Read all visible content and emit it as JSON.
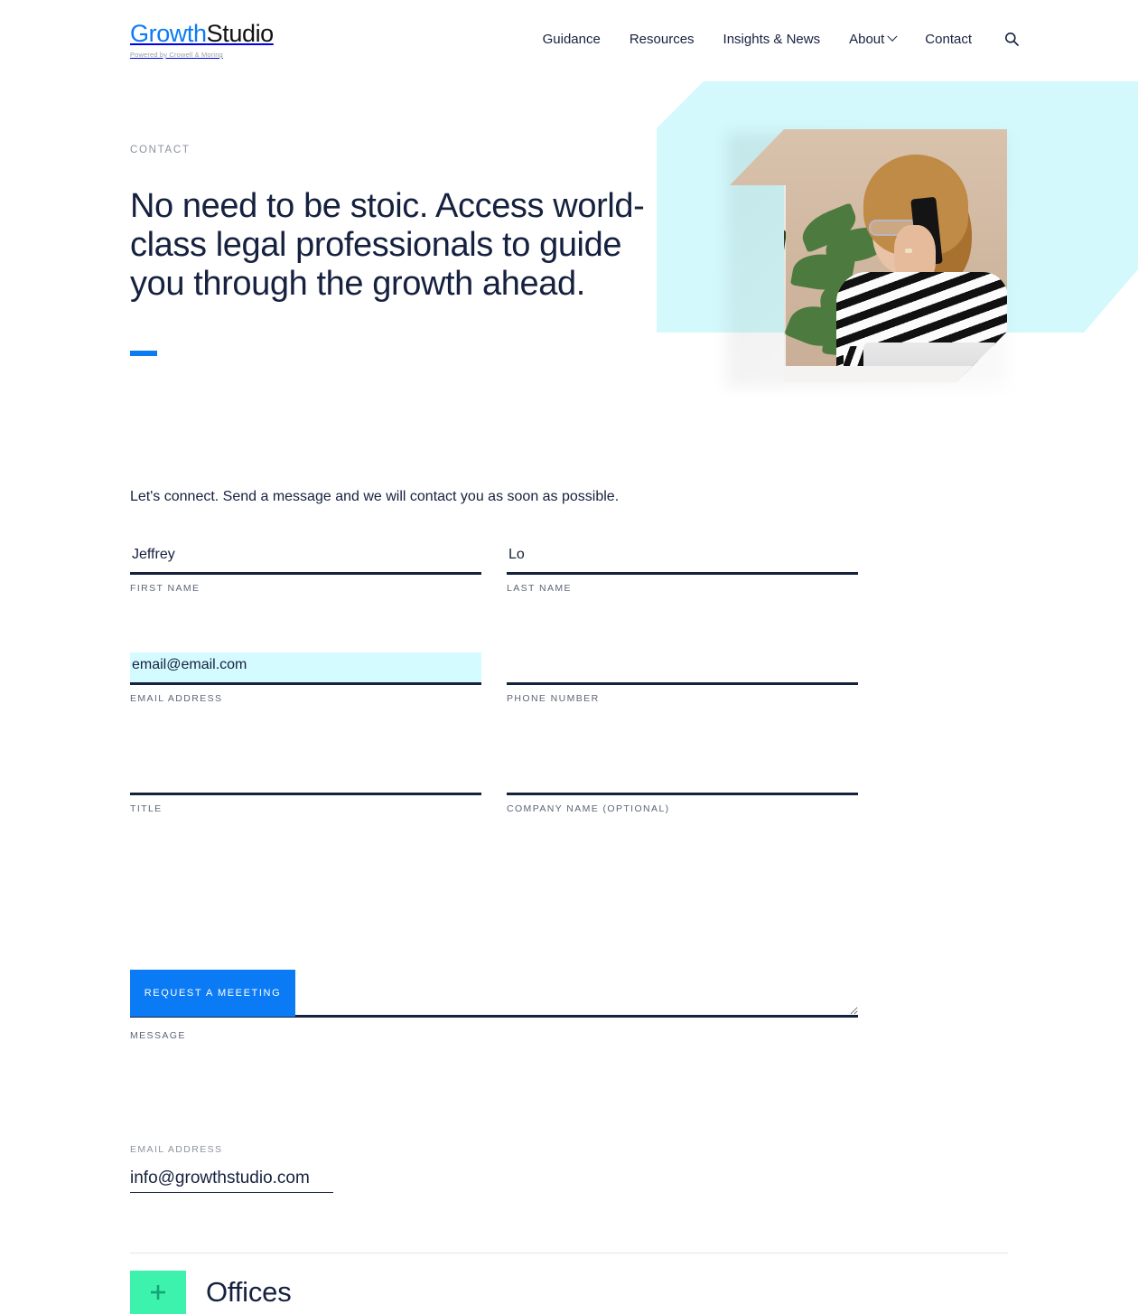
{
  "brand": {
    "name_part1": "Growth",
    "name_part2": "Studio",
    "tagline": "Powered by Crowell & Moring"
  },
  "nav": {
    "items": [
      {
        "label": "Guidance",
        "has_dropdown": false
      },
      {
        "label": "Resources",
        "has_dropdown": false
      },
      {
        "label": "Insights & News",
        "has_dropdown": false
      },
      {
        "label": "About",
        "has_dropdown": true
      },
      {
        "label": "Contact",
        "has_dropdown": false
      }
    ],
    "search_icon": "search-icon"
  },
  "hero": {
    "eyebrow": "CONTACT",
    "title": "No need to be stoic. Access world-class legal professionals to guide you through the growth ahead.",
    "photo_alt": "woman with glasses talking on a mobile phone at a desk with plants"
  },
  "form": {
    "intro": "Let's connect. Send a message and we will contact you as soon as possible.",
    "fields": [
      {
        "label": "FIRST NAME",
        "value": "Jeffrey",
        "placeholder": "",
        "highlighted": false
      },
      {
        "label": "LAST NAME",
        "value": "Lo",
        "placeholder": "",
        "highlighted": false
      },
      {
        "label": "EMAIL ADDRESS",
        "value": "email@email.com",
        "placeholder": "",
        "highlighted": true
      },
      {
        "label": "PHONE NUMBER",
        "value": "",
        "placeholder": "",
        "highlighted": false
      },
      {
        "label": "TITLE",
        "value": "",
        "placeholder": "",
        "highlighted": false
      },
      {
        "label": "COMPANY NAME (OPTIONAL)",
        "value": "",
        "placeholder": "",
        "highlighted": false
      },
      {
        "label": "MESSAGE",
        "value": "",
        "placeholder": "",
        "highlighted": false
      }
    ],
    "submit_label": "REQUEST A MEEETING"
  },
  "contact_info": {
    "email_label": "EMAIL ADDRESS",
    "email_value": "info@growthstudio.com"
  },
  "accordion": {
    "plus_icon": "plus-icon",
    "title": "Offices"
  },
  "colors": {
    "accent_blue": "#0b7bf5",
    "dark_navy": "#16213f",
    "cyan_shape": "#d4f9fc",
    "cyan_highlight": "#d4fbff",
    "mint_green": "#3cf2ad",
    "muted_label": "#8c929c"
  }
}
